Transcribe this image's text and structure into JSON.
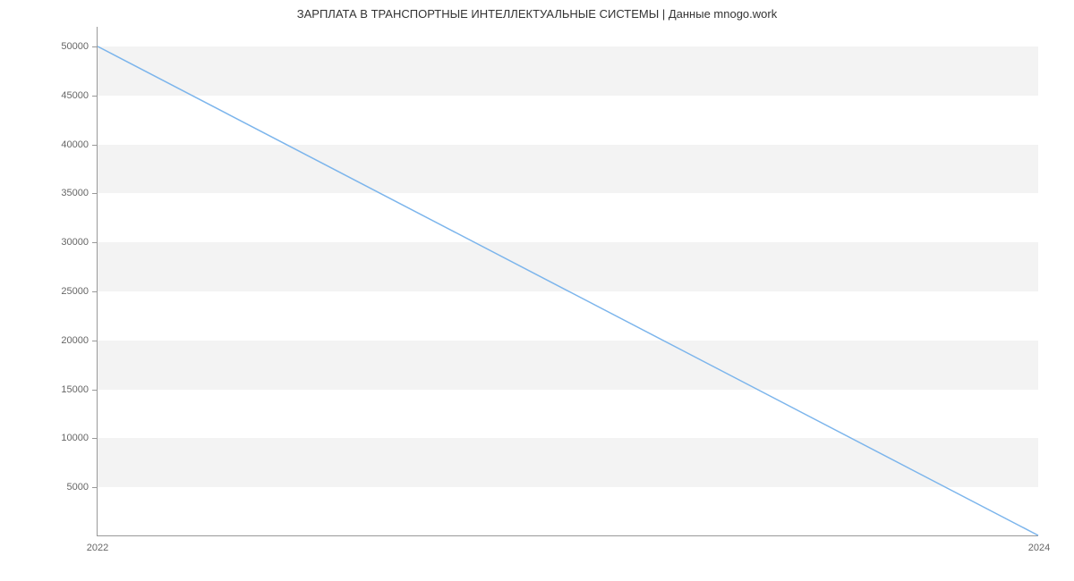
{
  "chart_data": {
    "type": "line",
    "title": "ЗАРПЛАТА В ТРАНСПОРТНЫЕ ИНТЕЛЛЕКТУАЛЬНЫЕ СИСТЕМЫ | Данные mnogo.work",
    "x": [
      2022,
      2024
    ],
    "values": [
      50000,
      0
    ],
    "xlabel": "",
    "ylabel": "",
    "xticks": [
      2022,
      2024
    ],
    "yticks": [
      5000,
      10000,
      15000,
      20000,
      25000,
      30000,
      35000,
      40000,
      45000,
      50000
    ],
    "ylim": [
      0,
      52000
    ],
    "xlim": [
      2022,
      2024
    ],
    "line_color": "#7cb5ec"
  }
}
